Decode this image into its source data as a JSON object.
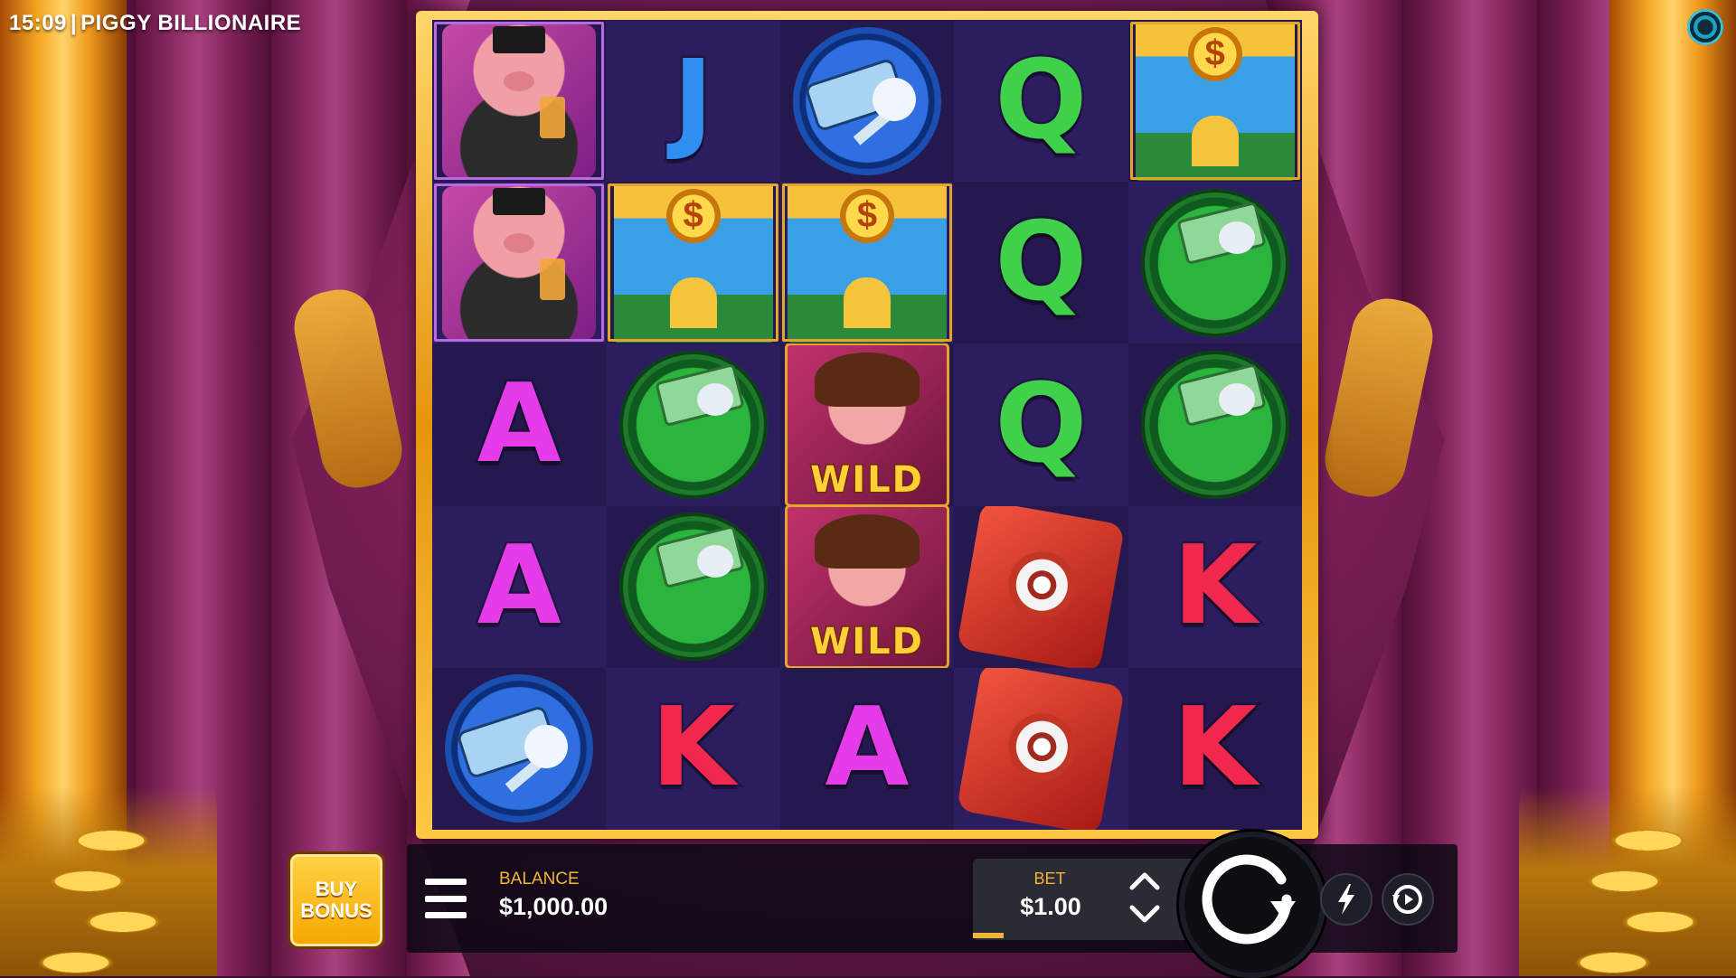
{
  "header": {
    "time": "15:09",
    "separator": "|",
    "title": "PIGGY BILLIONAIRE"
  },
  "icons": {
    "provider_logo": "provider-logo-icon",
    "menu": "hamburger-menu-icon",
    "bet_up": "chevron-up-icon",
    "bet_down": "chevron-down-icon",
    "spin": "spin-arrow-icon",
    "turbo": "lightning-icon",
    "autoplay": "autoplay-icon"
  },
  "colors": {
    "frame_gold": "#e6940f",
    "accent_label": "#f0b43a",
    "letter_j": "#2f8ff0",
    "letter_q": "#3fd14a",
    "letter_a": "#e43ce8",
    "letter_k": "#f0284e"
  },
  "reels": {
    "rows": [
      [
        "pig-tycoon",
        "J",
        "car-key",
        "Q",
        "bank"
      ],
      [
        "pig-tycoon",
        "bank",
        "bank",
        "Q",
        "money-wallet"
      ],
      [
        "A",
        "money-wallet",
        "wild",
        "Q",
        "money-wallet"
      ],
      [
        "A",
        "money-wallet",
        "wild",
        "safe",
        "K"
      ],
      [
        "car-key",
        "K",
        "A",
        "safe",
        "K"
      ]
    ],
    "wild_label": "WILD",
    "bank_coin_symbol": "$"
  },
  "controls": {
    "buy_bonus": {
      "line1": "BUY",
      "line2": "BONUS"
    },
    "balance_label": "BALANCE",
    "balance_value": "$1,000.00",
    "bet_label": "BET",
    "bet_value": "$1.00"
  }
}
